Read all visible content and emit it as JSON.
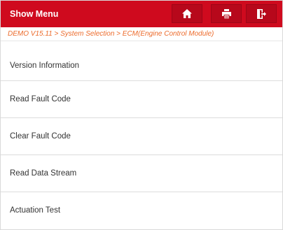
{
  "header": {
    "title": "Show Menu",
    "buttons": [
      {
        "icon": "home-icon"
      },
      {
        "icon": "print-icon"
      },
      {
        "icon": "exit-icon"
      }
    ],
    "color": "#cf0a1e"
  },
  "breadcrumb": "DEMO V15.11 > System Selection > ECM(Engine Control Module)",
  "menu": {
    "items": [
      {
        "label": "Version Information"
      },
      {
        "label": "Read Fault Code"
      },
      {
        "label": "Clear Fault Code"
      },
      {
        "label": "Read Data Stream"
      },
      {
        "label": "Actuation Test"
      }
    ]
  }
}
